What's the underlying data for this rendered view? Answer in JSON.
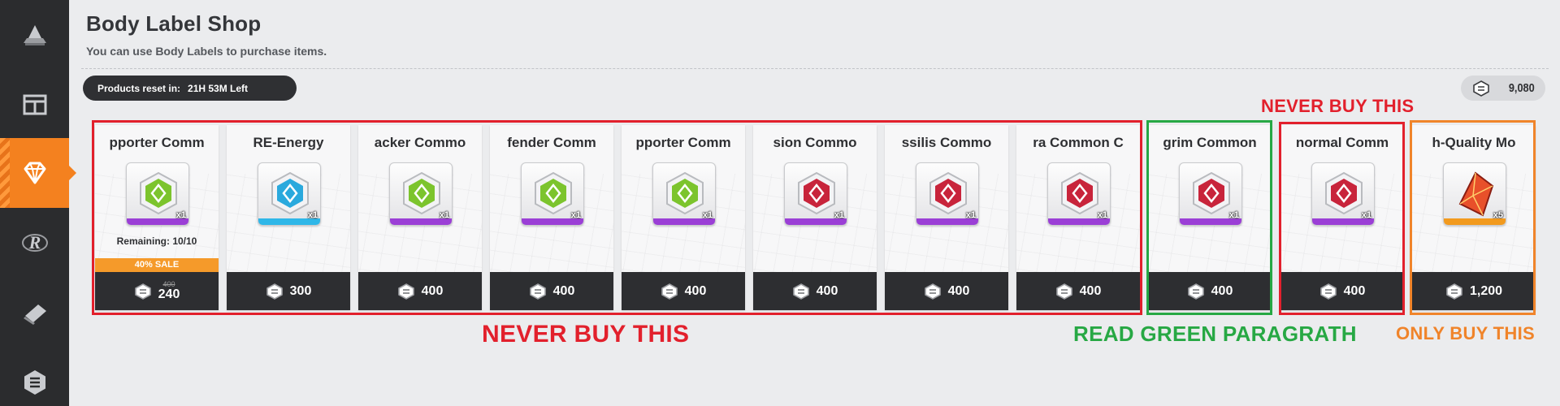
{
  "header": {
    "title": "Body Label Shop",
    "subtitle": "You can use Body Labels to purchase items.",
    "reset_label": "Products reset in:",
    "reset_time": "21H 53M Left",
    "currency_amount": "9,080"
  },
  "sidebar": {
    "items": [
      {
        "icon": "anvil-icon",
        "active": false
      },
      {
        "icon": "store-layout-icon",
        "active": false
      },
      {
        "icon": "diamond-icon",
        "active": true
      },
      {
        "icon": "r-logo-icon",
        "active": false
      },
      {
        "icon": "card-stack-icon",
        "active": false
      },
      {
        "icon": "hexagon-emblem-icon",
        "active": false
      }
    ]
  },
  "cards": [
    {
      "name": "pporter Comm",
      "qty": "x1",
      "remaining": "Remaining: 10/10",
      "sale": "40% SALE",
      "old_price": "400",
      "price": "240",
      "stripe": "#9b3fd6",
      "emblem": "#7cc42d"
    },
    {
      "name": "RE-Energy",
      "qty": "x1",
      "price": "300",
      "stripe": "#2fb7e8",
      "emblem": "#2aa9dd"
    },
    {
      "name": "acker Commo",
      "qty": "x1",
      "price": "400",
      "stripe": "#9b3fd6",
      "emblem": "#7cc42d"
    },
    {
      "name": "fender Comm",
      "qty": "x1",
      "price": "400",
      "stripe": "#9b3fd6",
      "emblem": "#7cc42d"
    },
    {
      "name": "pporter Comm",
      "qty": "x1",
      "price": "400",
      "stripe": "#9b3fd6",
      "emblem": "#7cc42d"
    },
    {
      "name": "sion Commo",
      "qty": "x1",
      "price": "400",
      "stripe": "#9b3fd6",
      "emblem": "#c8243b"
    },
    {
      "name": "ssilis Commo",
      "qty": "x1",
      "price": "400",
      "stripe": "#9b3fd6",
      "emblem": "#c8243b"
    },
    {
      "name": "ra Common C",
      "qty": "x1",
      "price": "400",
      "stripe": "#9b3fd6",
      "emblem": "#c8243b"
    },
    {
      "name": "grim Common",
      "qty": "x1",
      "price": "400",
      "stripe": "#9b3fd6",
      "emblem": "#c8243b"
    },
    {
      "name": "normal Comm",
      "qty": "x1",
      "price": "400",
      "stripe": "#9b3fd6",
      "emblem": "#c8243b"
    },
    {
      "name": "h-Quality Mo",
      "qty": "x5",
      "price": "1,200",
      "stripe": "#f29a1e",
      "emblem": "#e8502a"
    }
  ],
  "annotations": {
    "never_buy_main": "NEVER BUY THIS",
    "never_buy_top": "NEVER BUY THIS",
    "read_green": "READ GREEN PARAGRATH",
    "only_buy": "ONLY BUY THIS"
  },
  "colors": {
    "accent": "#f4811f",
    "annotation_red": "#e2202c",
    "annotation_green": "#27a844",
    "annotation_orange": "#f0842a"
  }
}
